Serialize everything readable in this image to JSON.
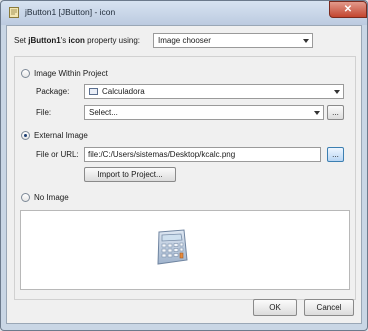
{
  "window": {
    "title": "jButton1 [JButton] - icon",
    "close_glyph": "✕"
  },
  "header": {
    "prefix": "Set ",
    "component": "jButton1",
    "suffix": "'s ",
    "property": "icon",
    "after": " property using:",
    "mode": "Image chooser"
  },
  "project": {
    "radio_label": "Image Within Project",
    "package_label": "Package:",
    "package_value": "Calculadora",
    "file_label": "File:",
    "file_value": "Select...",
    "browse_label": "..."
  },
  "external": {
    "radio_label": "External Image",
    "url_label": "File or URL:",
    "url_value": "file:/C:/Users/sistemas/Desktop/kcalc.png",
    "browse_label": "...",
    "import_label": "Import to Project..."
  },
  "noimage": {
    "radio_label": "No Image"
  },
  "footer": {
    "ok_label": "OK",
    "cancel_label": "Cancel"
  },
  "selected_option": "External Image"
}
